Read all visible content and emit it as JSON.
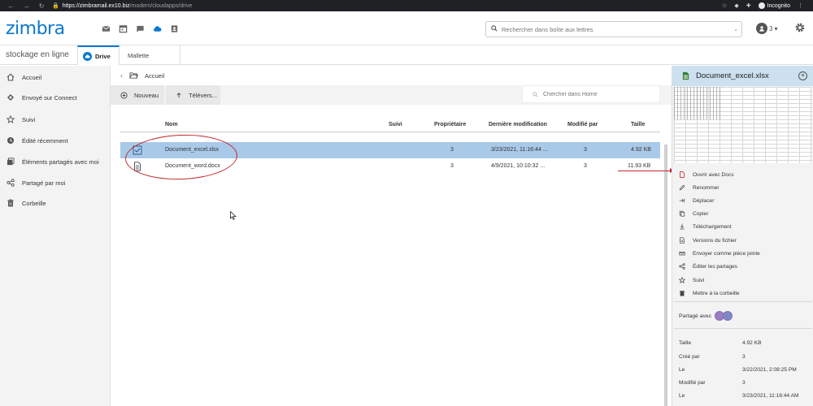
{
  "browser": {
    "url_host": "https://zimbramail.ex10.biz",
    "url_path": "/modern/cloudapps/drive",
    "incognito_label": "Incognito"
  },
  "header": {
    "logo": "zimbra",
    "search_placeholder": "Rechercher dans boîte aux lettres",
    "user_badge": "3"
  },
  "tabs": {
    "app_title": "stockage en ligne",
    "drive": "Drive",
    "mallette": "Mallette"
  },
  "sidebar": {
    "items": [
      {
        "label": "Accueil",
        "icon": "home-icon"
      },
      {
        "label": "Envoyé sur Connect",
        "icon": "connect-icon"
      },
      {
        "label": "Suivi",
        "icon": "star-icon"
      },
      {
        "label": "Édité récemment",
        "icon": "clock-icon"
      },
      {
        "label": "Éléments partagés avec moi",
        "icon": "shared-with-me-icon"
      },
      {
        "label": "Partagé par moi",
        "icon": "share-icon"
      },
      {
        "label": "Corbeille",
        "icon": "trash-icon"
      }
    ]
  },
  "breadcrumb": {
    "folder": "Accueil"
  },
  "toolbar": {
    "new_label": "Nouveau",
    "upload_label": "Télévers...",
    "filter_placeholder": "Chercher dans Home"
  },
  "table": {
    "headers": {
      "name": "Nom",
      "followed": "Suivi",
      "owner": "Propriétaire",
      "modified": "Dernière modification",
      "modified_by": "Modifié par",
      "size": "Taille"
    },
    "rows": [
      {
        "name": "Document_excel.xlsx",
        "owner": "3",
        "modified": "3/23/2021, 11:16:44 ...",
        "modified_by": "3",
        "size": "4.92 KB",
        "selected": true
      },
      {
        "name": "Document_word.docx",
        "owner": "3",
        "modified": "4/9/2021, 10:10:32 ...",
        "modified_by": "3",
        "size": "11.93 KB",
        "selected": false
      }
    ]
  },
  "panel": {
    "title": "Document_excel.xlsx",
    "actions": [
      {
        "label": "Ouvrir avec Docs",
        "icon": "document-icon"
      },
      {
        "label": "Renommer",
        "icon": "pencil-icon"
      },
      {
        "label": "Déplacer",
        "icon": "move-icon"
      },
      {
        "label": "Copier",
        "icon": "copy-icon"
      },
      {
        "label": "Téléchargement",
        "icon": "download-icon"
      },
      {
        "label": "Versions du fichier",
        "icon": "versions-icon"
      },
      {
        "label": "Envoyer comme pièce jointe",
        "icon": "attach-icon"
      },
      {
        "label": "Éditer les partages",
        "icon": "share-icon"
      },
      {
        "label": "Suivi",
        "icon": "star-icon"
      },
      {
        "label": "Mettre à la corbeille",
        "icon": "trash-icon"
      }
    ],
    "shared_with_label": "Partagé avec",
    "meta": [
      {
        "key": "Taille",
        "value": "4.92 KB"
      },
      {
        "key": "Créé par",
        "value": "3"
      },
      {
        "key": "Le",
        "value": "3/22/2021, 2:08:25 PM"
      },
      {
        "key": "Modifié par",
        "value": "3"
      },
      {
        "key": "Le",
        "value": "3/23/2021, 11:16:44 AM"
      }
    ]
  },
  "colors": {
    "accent": "#0a78d0",
    "selection": "#a9c9e8",
    "annotation": "#c0272d"
  }
}
